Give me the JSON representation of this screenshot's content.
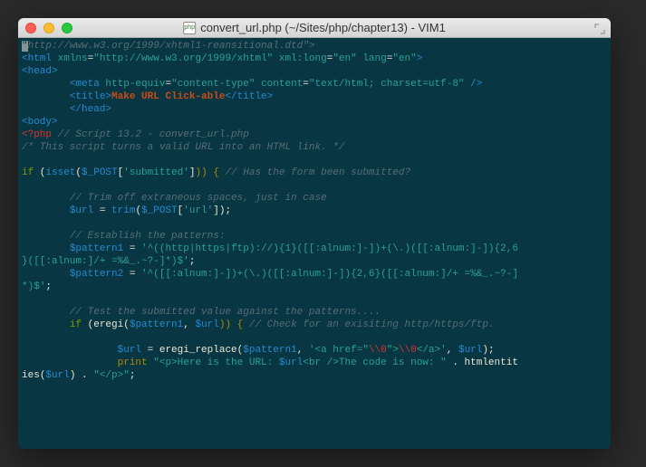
{
  "titlebar": {
    "file_icon_text": "php",
    "title": "convert_url.php (~/Sites/php/chapter13) - VIM1"
  },
  "code": {
    "l1_cursor": "\"",
    "l1_rest": "http://www.w3.org/1999/xhtml1-reansitional.dtd\">",
    "l2_a": "<html",
    "l2_b": " xmlns",
    "l2_c": "=",
    "l2_d": "\"http://www.w3.org/1999/xhtml\"",
    "l2_e": " xml:",
    "l2_f": "long",
    "l2_g": "=",
    "l2_h": "\"en\"",
    "l2_i": " lang",
    "l2_j": "=",
    "l2_k": "\"en\"",
    "l2_l": ">",
    "l3_a": "<head>",
    "l4_a": "        ",
    "l4_b": "<meta",
    "l4_c": " http-equiv",
    "l4_d": "=",
    "l4_e": "\"content-type\"",
    "l4_f": " content",
    "l4_g": "=",
    "l4_h": "\"text/html; charset=utf-8\"",
    "l4_i": " />",
    "l5_a": "        ",
    "l5_b": "<title>",
    "l5_c": "Make URL Click-able",
    "l5_d": "</title>",
    "l6_a": "        ",
    "l6_b": "</head>",
    "l7_a": "<body>",
    "l8_a": "<?php",
    "l8_b": " // Script 13.2 - convert_url.php",
    "l9_a": "/* This script turns a valid URL into an HTML link. */",
    "l11_a": "if",
    "l11_b": " (",
    "l11_c": "isset",
    "l11_d": "(",
    "l11_e": "$_POST",
    "l11_f": "[",
    "l11_g": "'submitted'",
    "l11_h": "]",
    "l11_i": ")) {",
    "l11_j": " // Has the form been submitted?",
    "l13_a": "        // Trim off extraneous spaces, just in case",
    "l14_a": "        ",
    "l14_b": "$url",
    "l14_c": " = ",
    "l14_d": "trim",
    "l14_e": "(",
    "l14_f": "$_POST",
    "l14_g": "[",
    "l14_h": "'url'",
    "l14_i": "]);",
    "l16_a": "        // Establish the patterns:",
    "l17_a": "        ",
    "l17_b": "$pattern1",
    "l17_c": " = ",
    "l17_d": "'^((http|https|ftp)://){1}([[:alnum:]-])+(\\.)([[:alnum:]-]){2,6",
    "l17e_a": "}([[:alnum:]/+ =%&_.~?-]*)$'",
    "l17e_b": ";",
    "l18_a": "        ",
    "l18_b": "$pattern2",
    "l18_c": " = ",
    "l18_d": "'^([[:alnum:]-])+(\\.)([[:alnum:]-]){2,6}([[:alnum:]/+ =%&_.~?-]",
    "l18e_a": "*)$'",
    "l18e_b": ";",
    "l20_a": "        // Test the submitted value against the patterns....",
    "l21_a": "        ",
    "l21_b": "if",
    "l21_c": " (",
    "l21_d": "eregi",
    "l21_e": "(",
    "l21_f": "$pattern1",
    "l21_g": ", ",
    "l21_h": "$url",
    "l21_i": ")) {",
    "l21_j": " // Check for an exisiting http/https/ftp.",
    "l23_a": "                ",
    "l23_b": "$url",
    "l23_c": " = ",
    "l23_d": "eregi_replace",
    "l23_e": "(",
    "l23_f": "$pattern1",
    "l23_g": ", ",
    "l23_h": "'<a href=\"",
    "l23_i": "\\\\0",
    "l23_j": "\">",
    "l23_k": "\\\\0",
    "l23_l": "</a>'",
    "l23_m": ", ",
    "l23_n": "$url",
    "l23_o": ");",
    "l24_a": "                ",
    "l24_b": "print",
    "l24_c": " \"<p>Here is the URL: ",
    "l24_d": "$url",
    "l24_e": "<br />The code is now: \"",
    "l24_f": " . ",
    "l24_g": "htmlentit",
    "l24e_a": "ies",
    "l24e_b": "(",
    "l24e_c": "$url",
    "l24e_d": ") . ",
    "l24e_e": "\"</p>\"",
    "l24e_f": ";"
  }
}
